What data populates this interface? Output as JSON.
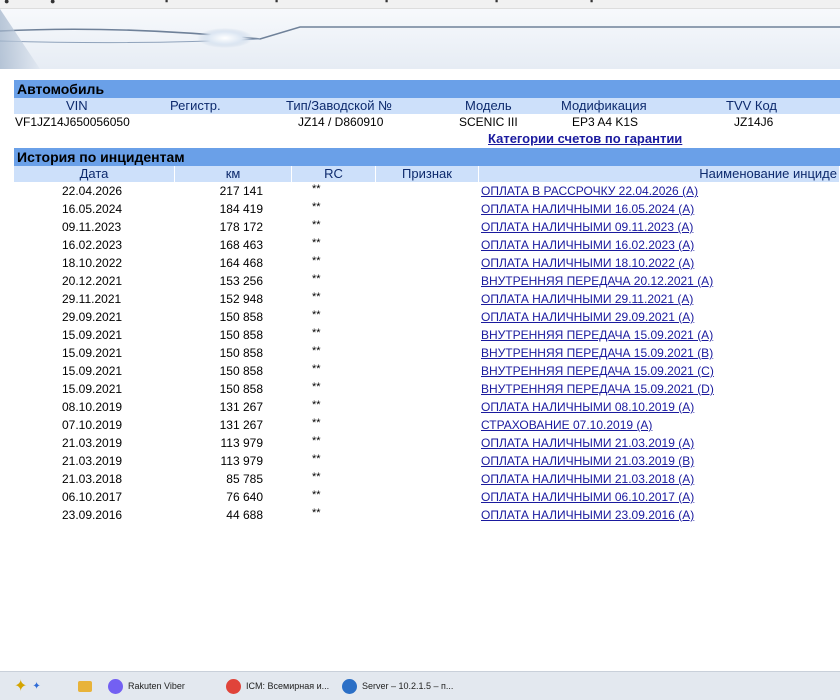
{
  "vehicle": {
    "section_title": "Автомобиль",
    "headers": {
      "vin": "VIN",
      "reg": "Регистр.",
      "type": "Тип/Заводской №",
      "model": "Модель",
      "mod": "Модификация",
      "tvv": "TVV Код"
    },
    "values": {
      "vin": "VF1JZ14J650056050",
      "reg": "",
      "type": "JZ14 / D860910",
      "model": "SCENIC III",
      "mod": "EP3 A4 K1S",
      "tvv": "JZ14J6"
    },
    "warranty_link": "Категории счетов по гарантии"
  },
  "history": {
    "section_title": "История по инцидентам",
    "headers": {
      "date": "Дата",
      "km": "км",
      "rc": "RC",
      "flag": "Признак",
      "name": "Наименование инциде"
    },
    "rows": [
      {
        "date": "22.04.2026",
        "km": "217 141",
        "rc": "**",
        "name": "ОПЛАТА В РАССРОЧКУ 22.04.2026 (A)"
      },
      {
        "date": "16.05.2024",
        "km": "184 419",
        "rc": "**",
        "name": "ОПЛАТА НАЛИЧНЫМИ 16.05.2024 (A)"
      },
      {
        "date": "09.11.2023",
        "km": "178 172",
        "rc": "**",
        "name": "ОПЛАТА НАЛИЧНЫМИ 09.11.2023 (A)"
      },
      {
        "date": "16.02.2023",
        "km": "168 463",
        "rc": "**",
        "name": "ОПЛАТА НАЛИЧНЫМИ 16.02.2023 (A)"
      },
      {
        "date": "18.10.2022",
        "km": "164 468",
        "rc": "**",
        "name": "ОПЛАТА НАЛИЧНЫМИ 18.10.2022 (A)"
      },
      {
        "date": "20.12.2021",
        "km": "153 256",
        "rc": "**",
        "name": "ВНУТРЕННЯЯ ПЕРЕДАЧА 20.12.2021 (A)"
      },
      {
        "date": "29.11.2021",
        "km": "152 948",
        "rc": "**",
        "name": "ОПЛАТА НАЛИЧНЫМИ 29.11.2021 (A)"
      },
      {
        "date": "29.09.2021",
        "km": "150 858",
        "rc": "**",
        "name": "ОПЛАТА НАЛИЧНЫМИ 29.09.2021 (A)"
      },
      {
        "date": "15.09.2021",
        "km": "150 858",
        "rc": "**",
        "name": "ВНУТРЕННЯЯ ПЕРЕДАЧА 15.09.2021 (A)"
      },
      {
        "date": "15.09.2021",
        "km": "150 858",
        "rc": "**",
        "name": "ВНУТРЕННЯЯ ПЕРЕДАЧА 15.09.2021 (B)"
      },
      {
        "date": "15.09.2021",
        "km": "150 858",
        "rc": "**",
        "name": "ВНУТРЕННЯЯ ПЕРЕДАЧА 15.09.2021 (C)"
      },
      {
        "date": "15.09.2021",
        "km": "150 858",
        "rc": "**",
        "name": "ВНУТРЕННЯЯ ПЕРЕДАЧА 15.09.2021 (D)"
      },
      {
        "date": "08.10.2019",
        "km": "131 267",
        "rc": "**",
        "name": "ОПЛАТА НАЛИЧНЫМИ 08.10.2019 (A)"
      },
      {
        "date": "07.10.2019",
        "km": "131 267",
        "rc": "**",
        "name": "СТРАХОВАНИЕ 07.10.2019 (A)"
      },
      {
        "date": "21.03.2019",
        "km": "113 979",
        "rc": "**",
        "name": "ОПЛАТА НАЛИЧНЫМИ 21.03.2019 (A)"
      },
      {
        "date": "21.03.2019",
        "km": "113 979",
        "rc": "**",
        "name": "ОПЛАТА НАЛИЧНЫМИ 21.03.2019 (B)"
      },
      {
        "date": "21.03.2018",
        "km": "85 785",
        "rc": "**",
        "name": "ОПЛАТА НАЛИЧНЫМИ 21.03.2018 (A)"
      },
      {
        "date": "06.10.2017",
        "km": "76 640",
        "rc": "**",
        "name": "ОПЛАТА НАЛИЧНЫМИ 06.10.2017 (A)"
      },
      {
        "date": "23.09.2016",
        "km": "44 688",
        "rc": "**",
        "name": "ОПЛАТА НАЛИЧНЫМИ 23.09.2016 (A)"
      }
    ]
  },
  "taskbar": {
    "items": [
      {
        "label": "Rakuten Viber",
        "icon": "viber-icon",
        "color": "#7360f2"
      },
      {
        "label": "ICM: Всемирная и...",
        "icon": "chrome-icon",
        "color": "#e0443a"
      },
      {
        "label": "Server – 10.2.1.5 – п...",
        "icon": "remote-desktop-icon",
        "color": "#2b6fc6"
      }
    ]
  },
  "colors": {
    "section_bg": "#6aa0e8",
    "header_bg": "#cde0fa",
    "link": "#1a1a9e"
  }
}
